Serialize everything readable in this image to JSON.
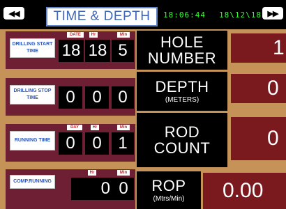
{
  "header": {
    "title": "TIME & DEPTH",
    "time": "18:06:44",
    "date": "18\\12\\18",
    "prev_icon": "rewind-icon",
    "next_icon": "fast-forward-icon",
    "prev_glyph": "◀◀",
    "next_glyph": "▶▶"
  },
  "panels": {
    "drilling_start": {
      "label": "DRILLING START TIME",
      "headers": [
        "DATE",
        "Hr",
        "Min"
      ],
      "values": [
        "18",
        "18",
        "5"
      ]
    },
    "drilling_stop": {
      "label": "DRILLING STOP TIME",
      "values": [
        "0",
        "0",
        "0"
      ]
    },
    "running": {
      "label": "RUNNING TIME",
      "headers": [
        "DAY",
        "Hr",
        "Min"
      ],
      "values": [
        "0",
        "0",
        "1"
      ]
    },
    "comp_running": {
      "label": "COMP.RUNNING",
      "headers": [
        "Hr",
        "Min"
      ],
      "values": [
        "0",
        "0"
      ]
    }
  },
  "metrics": {
    "hole": {
      "title": "HOLE NUMBER",
      "value": "1"
    },
    "depth": {
      "title": "DEPTH",
      "subtitle": "(METERS)",
      "value": "0"
    },
    "rod": {
      "title": "ROD COUNT",
      "value": "0"
    },
    "rop": {
      "title": "ROP",
      "subtitle": "(Mtrs/Min)",
      "value": "0.00"
    }
  },
  "colors": {
    "background": "#000000",
    "panel_orange": "#c59257",
    "panel_maroon": "#6f1f34",
    "value_red": "#7a1a1f",
    "clock_green": "#32ff32",
    "title_blue": "#3f68b8"
  }
}
